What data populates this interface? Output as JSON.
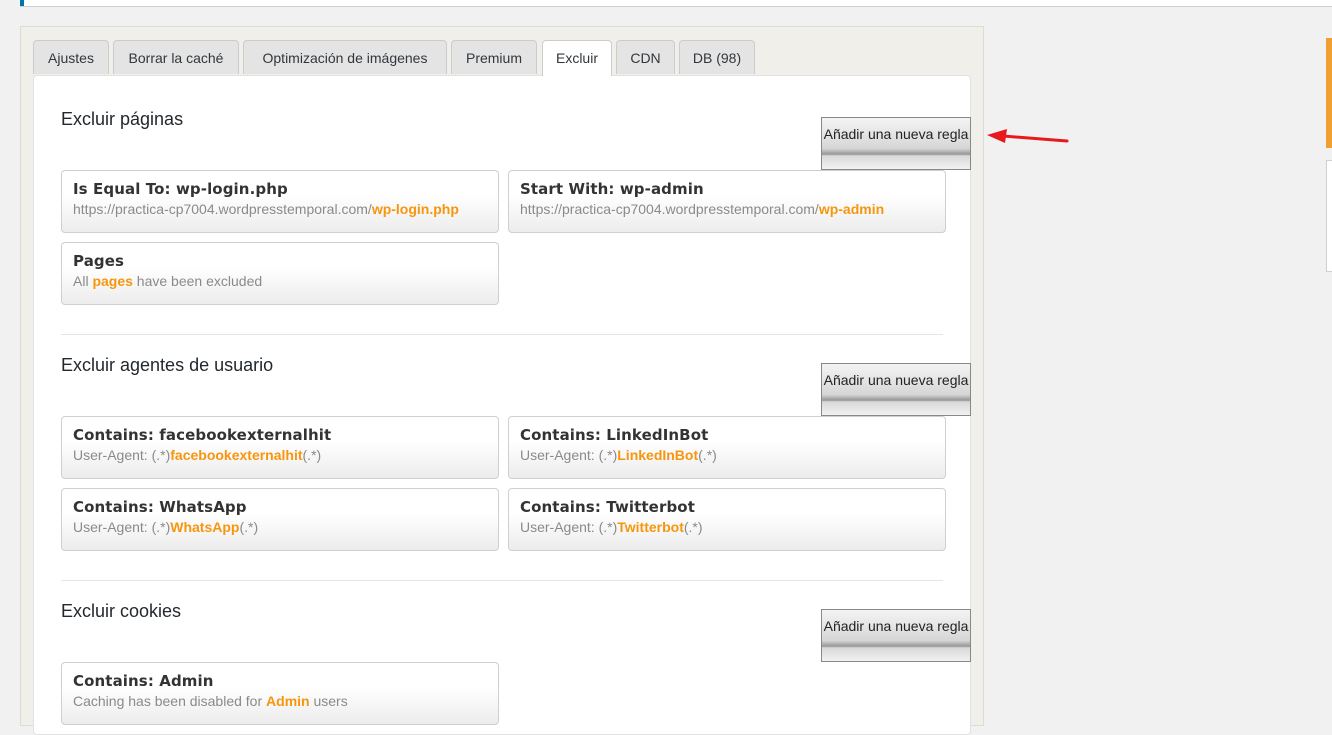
{
  "tabs": [
    {
      "label": "Ajustes"
    },
    {
      "label": "Borrar la caché"
    },
    {
      "label": "Optimización de imágenes"
    },
    {
      "label": "Premium"
    },
    {
      "label": "Excluir"
    },
    {
      "label": "CDN"
    },
    {
      "label": "DB (98)"
    }
  ],
  "active_tab": "Excluir",
  "add_rule_label": "Añadir una nueva regla",
  "sections": {
    "pages": {
      "title": "Excluir páginas",
      "rules": [
        {
          "title": "Is Equal To: wp-login.php",
          "prefix": "https://practica-cp7004.wordpresstemporal.com/",
          "highlight": "wp-login.php",
          "suffix": ""
        },
        {
          "title": "Start With: wp-admin",
          "prefix": "https://practica-cp7004.wordpresstemporal.com/",
          "highlight": "wp-admin",
          "suffix": ""
        },
        {
          "title": "Pages",
          "prefix": "All ",
          "highlight": "pages",
          "suffix": " have been excluded"
        }
      ]
    },
    "useragents": {
      "title": "Excluir agentes de usuario",
      "rules": [
        {
          "title": "Contains: facebookexternalhit",
          "prefix": "User-Agent: (.*)",
          "highlight": "facebookexternalhit",
          "suffix": "(.*)"
        },
        {
          "title": "Contains: LinkedInBot",
          "prefix": "User-Agent: (.*)",
          "highlight": "LinkedInBot",
          "suffix": "(.*)"
        },
        {
          "title": "Contains: WhatsApp",
          "prefix": "User-Agent: (.*)",
          "highlight": "WhatsApp",
          "suffix": "(.*)"
        },
        {
          "title": "Contains: Twitterbot",
          "prefix": "User-Agent: (.*)",
          "highlight": "Twitterbot",
          "suffix": "(.*)"
        }
      ]
    },
    "cookies": {
      "title": "Excluir cookies",
      "rules": [
        {
          "title": "Contains: Admin",
          "prefix": "Caching has been disabled for ",
          "highlight": "Admin",
          "suffix": " users"
        }
      ]
    }
  },
  "colors": {
    "highlight": "#f7960d",
    "arrow": "#e8191c",
    "side_accent": "#f0a030"
  }
}
